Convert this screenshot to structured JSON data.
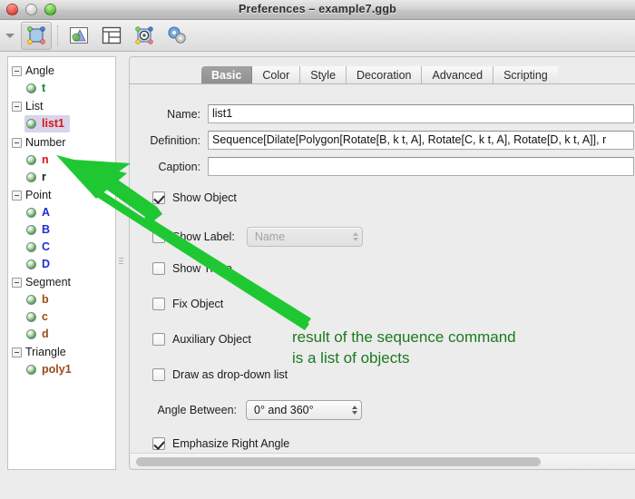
{
  "window": {
    "title": "Preferences – example7.ggb",
    "traffic_lights": [
      "close-button",
      "minimize-button",
      "zoom-button"
    ]
  },
  "toolbar": {
    "chevron": "chevron-down-icon",
    "buttons": [
      {
        "name": "objects-properties-button",
        "icon": "selected-quadrilateral-icon",
        "active": true
      },
      {
        "name": "graphics-view-button",
        "icon": "cone-graphics-icon",
        "active": false
      },
      {
        "name": "layout-button",
        "icon": "layout-panels-icon",
        "active": false
      },
      {
        "name": "defaults-button",
        "icon": "object-gear-icon",
        "active": false
      },
      {
        "name": "advanced-settings-button",
        "icon": "gears-icon",
        "active": false
      }
    ]
  },
  "sidebar": {
    "groups": [
      {
        "label": "Angle",
        "items": [
          {
            "label": "t",
            "color": "#0a8a3a",
            "selected": false
          }
        ]
      },
      {
        "label": "List",
        "items": [
          {
            "label": "list1",
            "color": "#d81515",
            "selected": true
          }
        ]
      },
      {
        "label": "Number",
        "items": [
          {
            "label": "n",
            "color": "#d81515",
            "selected": false
          },
          {
            "label": "r",
            "color": "#1a1a1a",
            "selected": false
          }
        ]
      },
      {
        "label": "Point",
        "items": [
          {
            "label": "A",
            "color": "#1b2fd4",
            "selected": false
          },
          {
            "label": "B",
            "color": "#1b2fd4",
            "selected": false
          },
          {
            "label": "C",
            "color": "#1b2fd4",
            "selected": false
          },
          {
            "label": "D",
            "color": "#1b2fd4",
            "selected": false
          }
        ]
      },
      {
        "label": "Segment",
        "items": [
          {
            "label": "b",
            "color": "#9c4a18",
            "selected": false
          },
          {
            "label": "c",
            "color": "#9c4a18",
            "selected": false
          },
          {
            "label": "d",
            "color": "#9c4a18",
            "selected": false
          }
        ]
      },
      {
        "label": "Triangle",
        "items": [
          {
            "label": "poly1",
            "color": "#9c4a18",
            "selected": false
          }
        ]
      }
    ]
  },
  "panel": {
    "tabs": [
      {
        "label": "Basic",
        "active": true
      },
      {
        "label": "Color",
        "active": false
      },
      {
        "label": "Style",
        "active": false
      },
      {
        "label": "Decoration",
        "active": false
      },
      {
        "label": "Advanced",
        "active": false
      },
      {
        "label": "Scripting",
        "active": false
      }
    ],
    "fields": {
      "name_label": "Name:",
      "name_value": "list1",
      "definition_label": "Definition:",
      "definition_value": "Sequence[Dilate[Polygon[Rotate[B, k t, A], Rotate[C, k t, A], Rotate[D, k t, A]], r",
      "caption_label": "Caption:",
      "caption_value": ""
    },
    "checkboxes": [
      {
        "label": "Show Object",
        "checked": true
      },
      {
        "label": "Show Label:",
        "checked": false
      },
      {
        "label": "Show Trace",
        "checked": false
      },
      {
        "label": "Fix Object",
        "checked": false
      },
      {
        "label": "Auxiliary Object",
        "checked": false
      },
      {
        "label": "Draw as drop-down list",
        "checked": false
      },
      {
        "label": "Emphasize Right Angle",
        "checked": true
      }
    ],
    "label_combo": {
      "value": "Name",
      "disabled": true
    },
    "angle_between": {
      "label": "Angle Between:",
      "value": "0° and 360°"
    }
  },
  "annotation": {
    "line1": "result of the sequence command",
    "line2": "is a list of objects",
    "color": "#1a7a1f",
    "arrow": "green-arrow-pointing-to-list1"
  }
}
